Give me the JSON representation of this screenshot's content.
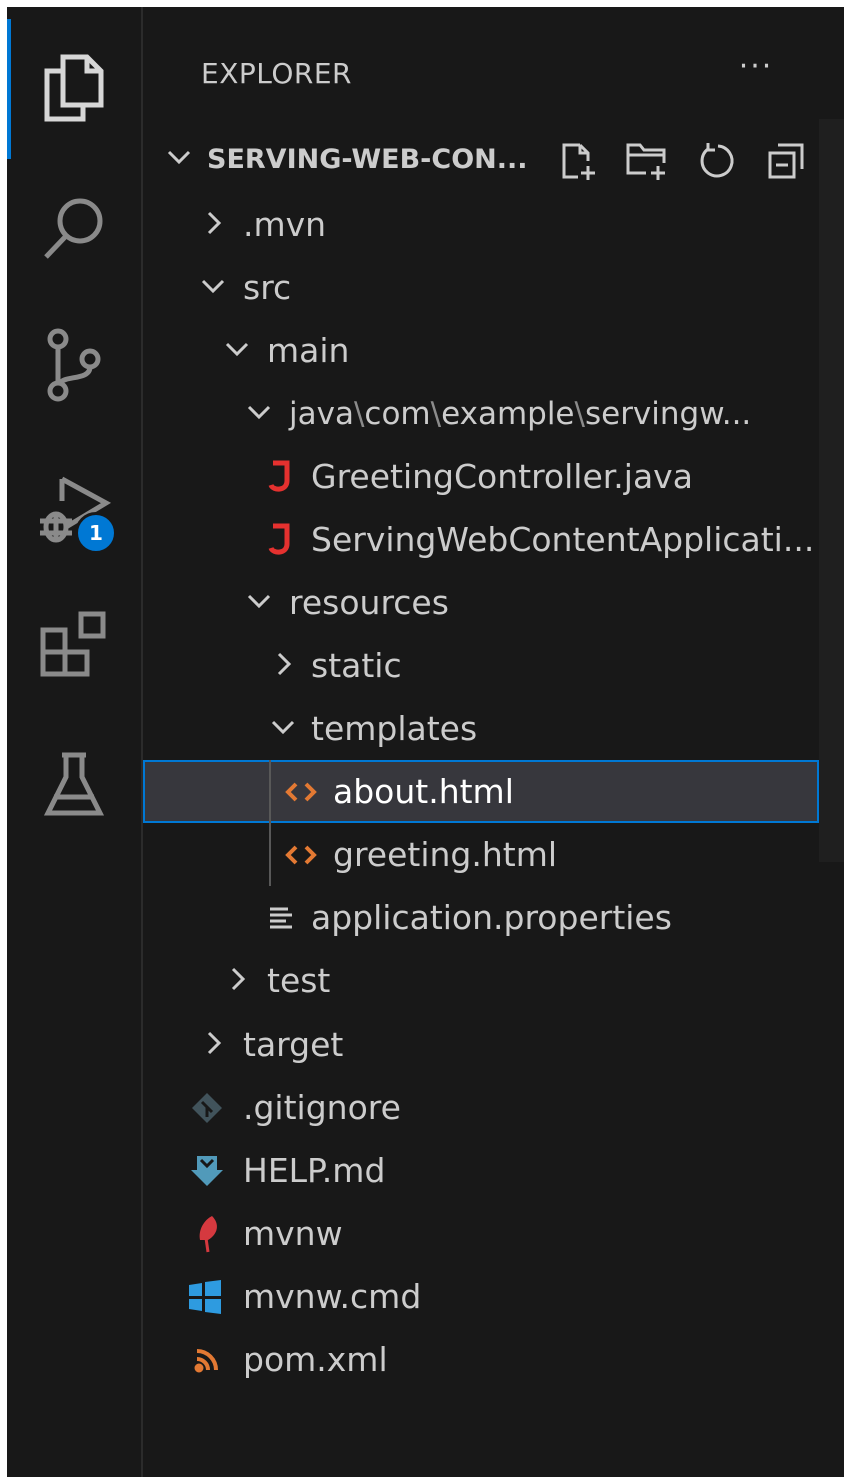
{
  "activity_bar": {
    "items": [
      {
        "name": "explorer-icon"
      },
      {
        "name": "search-icon"
      },
      {
        "name": "source-control-icon"
      },
      {
        "name": "run-debug-icon"
      },
      {
        "name": "extensions-icon"
      },
      {
        "name": "testing-icon"
      }
    ],
    "debug_badge": "1",
    "accent_color": "#0078d4"
  },
  "sidebar": {
    "title": "EXPLORER",
    "more_actions": "···",
    "section_title": "SERVING-WEB-CON...",
    "header_actions": [
      "new-file-icon",
      "new-folder-icon",
      "refresh-icon",
      "collapse-all-icon"
    ]
  },
  "tree": {
    "mvn": ".mvn",
    "src": "src",
    "main": "main",
    "java_path": {
      "p1": "java",
      "p2": "com",
      "p3": "example",
      "p4": "servingw..."
    },
    "path_separator": "\\",
    "greeting_controller": "GreetingController.java",
    "serving_app": "ServingWebContentApplicati...",
    "resources": "resources",
    "static": "static",
    "templates": "templates",
    "about": "about.html",
    "greeting": "greeting.html",
    "app_props": "application.properties",
    "test": "test",
    "target": "target",
    "gitignore": ".gitignore",
    "help": "HELP.md",
    "mvnw": "mvnw",
    "mvnw_cmd": "mvnw.cmd",
    "pom": "pom.xml"
  },
  "icon_colors": {
    "java": "#e5312f",
    "html": "#e37933",
    "git": "#41535b",
    "markdown": "#519aba",
    "mvnw": "#d5393f",
    "windows": "#2e9be0",
    "xml": "#e37933"
  }
}
